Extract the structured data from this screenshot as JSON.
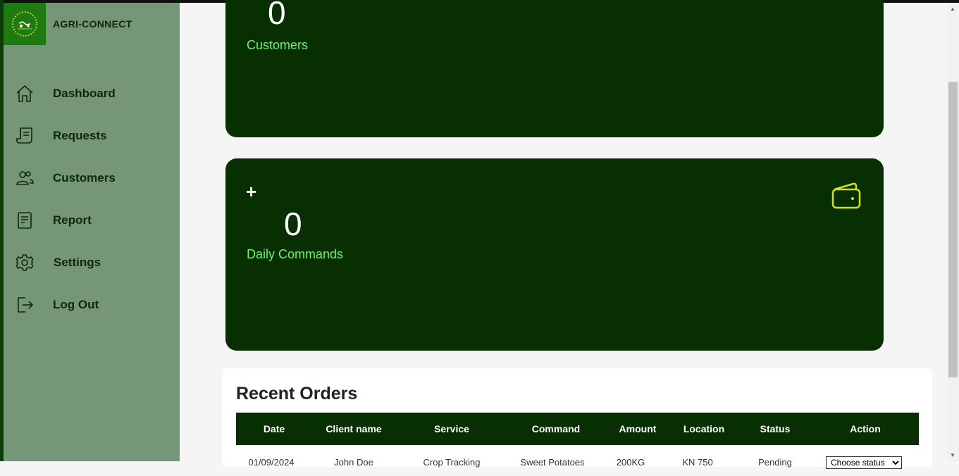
{
  "brand": {
    "name": "AGRI-CONNECT",
    "logo_icon": "tractor-logo-icon"
  },
  "sidebar": {
    "items": [
      {
        "label": "Dashboard",
        "icon": "home-icon"
      },
      {
        "label": "Requests",
        "icon": "receipt-icon"
      },
      {
        "label": "Customers",
        "icon": "users-icon"
      },
      {
        "label": "Report",
        "icon": "document-icon"
      },
      {
        "label": "Settings",
        "icon": "gear-icon"
      },
      {
        "label": "Log Out",
        "icon": "logout-icon"
      }
    ]
  },
  "cards": [
    {
      "value": "0",
      "label": "Customers"
    },
    {
      "prefix": "+",
      "value": "0",
      "label": "Daily Commands",
      "icon": "wallet-icon"
    }
  ],
  "recent_orders": {
    "title": "Recent Orders",
    "columns": [
      "Date",
      "Client name",
      "Service",
      "Command",
      "Amount",
      "Location",
      "Status",
      "Action"
    ],
    "rows": [
      {
        "date": "01/09/2024",
        "client": "John Doe",
        "service": "Crop Tracking",
        "command": "Sweet Potatoes",
        "amount": "200KG",
        "location": "KN 750",
        "status": "Pending",
        "action_placeholder": "Choose status"
      }
    ]
  },
  "colors": {
    "card_bg": "#082f02",
    "accent_green": "#6ef26e",
    "sidebar_bg": "#76967a",
    "icon_yellow": "#d4e600"
  }
}
